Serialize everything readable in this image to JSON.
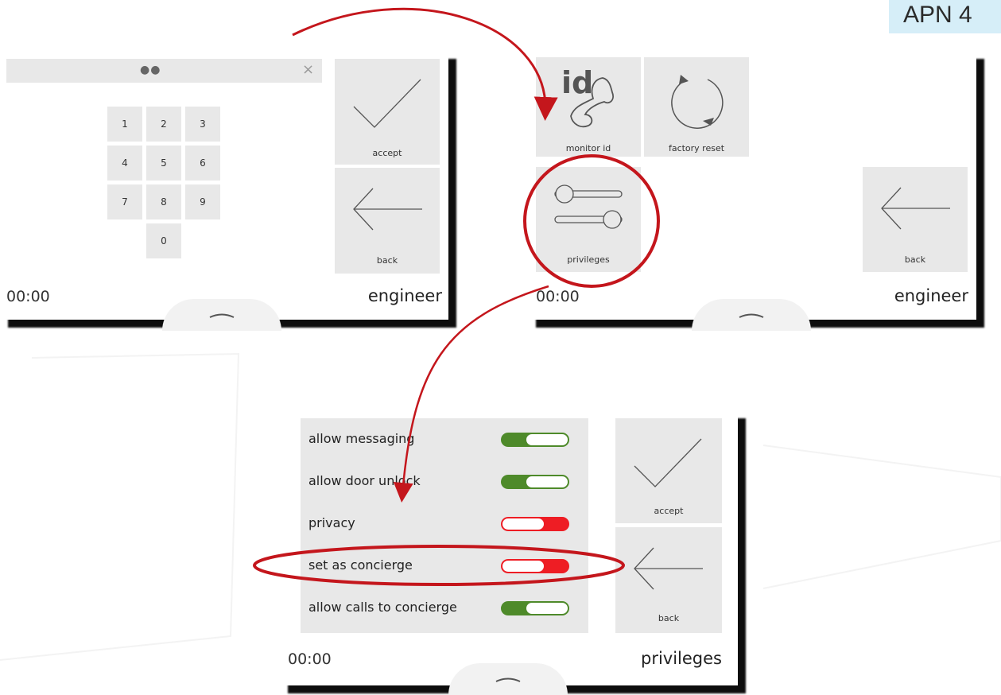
{
  "corner_tag": "APN 4",
  "colors": {
    "tile": "#e8e8e8",
    "on": "#4e8a2a",
    "off": "#ee1d24",
    "annotation": "#c4161c",
    "corner_tag_bg": "#d6eef8"
  },
  "screen1": {
    "pin_dots": "●●",
    "close_glyph": "×",
    "keys": [
      "1",
      "2",
      "3",
      "4",
      "5",
      "6",
      "7",
      "8",
      "9",
      "0"
    ],
    "accept_label": "accept",
    "back_label": "back",
    "clock": "00:00",
    "title": "engineer"
  },
  "screen2": {
    "monitor_id_glyph": "id",
    "monitor_id_label": "monitor id",
    "factory_reset_label": "factory reset",
    "privileges_label": "privileges",
    "back_label": "back",
    "clock": "00:00",
    "title": "engineer"
  },
  "screen3": {
    "settings": [
      {
        "label": "allow messaging",
        "state": "on"
      },
      {
        "label": "allow door unlock",
        "state": "on"
      },
      {
        "label": "privacy",
        "state": "off"
      },
      {
        "label": "set as concierge",
        "state": "off"
      },
      {
        "label": "allow calls to concierge",
        "state": "on"
      }
    ],
    "accept_label": "accept",
    "back_label": "back",
    "clock": "00:00",
    "title": "privileges"
  }
}
